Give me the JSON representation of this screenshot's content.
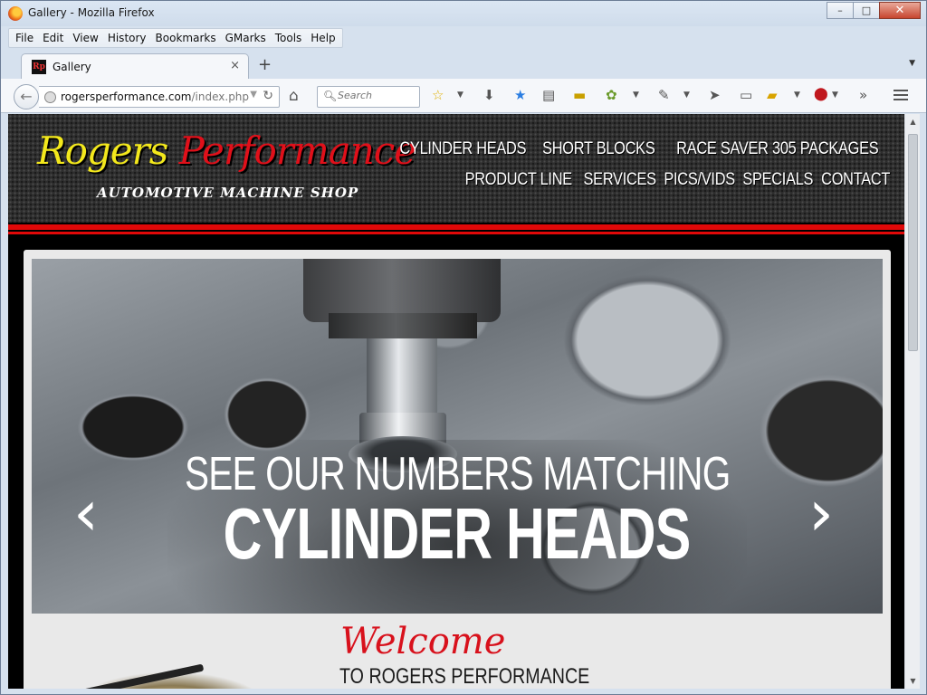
{
  "window": {
    "title": "Gallery - Mozilla Firefox",
    "buttons": {
      "minimize": "–",
      "maximize": "□",
      "close": "✕"
    }
  },
  "menubar": [
    "File",
    "Edit",
    "View",
    "History",
    "Bookmarks",
    "GMarks",
    "Tools",
    "Help"
  ],
  "tab": {
    "favicon_text": "Rp",
    "label": "Gallery",
    "close": "×",
    "new_tab": "+",
    "list": "▼"
  },
  "navbar": {
    "url_host": "rogersperformance.com",
    "url_path": "/index.php",
    "search_placeholder": "Search"
  },
  "site": {
    "logo_rogers": "Rogers",
    "logo_performance": "Performance",
    "tagline": "AUTOMOTIVE MACHINE SHOP",
    "nav_row1": [
      "CYLINDER HEADS",
      "SHORT BLOCKS",
      "RACE SAVER 305 PACKAGES"
    ],
    "nav_row2": [
      "PRODUCT LINE",
      "SERVICES",
      "PICS/VIDS",
      "SPECIALS",
      "CONTACT"
    ]
  },
  "hero": {
    "caption_line1": "SEE OUR NUMBERS MATCHING",
    "caption_line2": "CYLINDER HEADS",
    "prev": "‹",
    "next": "›"
  },
  "welcome": {
    "script": "Welcome",
    "subtitle": "TO ROGERS PERFORMANCE"
  },
  "colors": {
    "brand_red": "#e00808",
    "logo_yellow": "#f3e81c",
    "welcome_red": "#d8111c"
  }
}
